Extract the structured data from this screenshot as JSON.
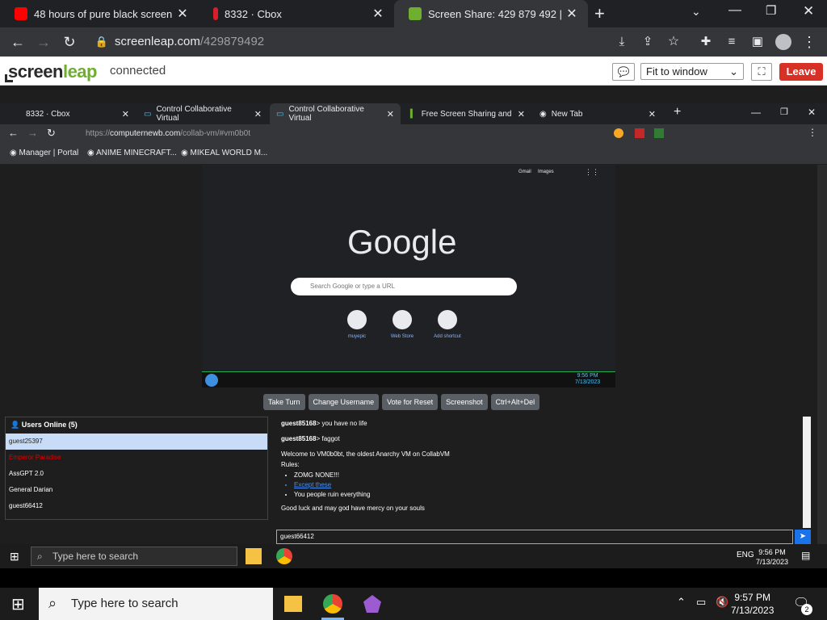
{
  "outer_tabs": [
    {
      "label": "48 hours of pure black screen in",
      "color": "#ff0000"
    },
    {
      "label": "8332 · Cbox",
      "color": "#d91e2a"
    },
    {
      "label": "Screen Share: 429 879 492 | Scre",
      "color": "#6fae2f"
    }
  ],
  "outer_url": {
    "domain": "screenleap.com",
    "path": "/429879492"
  },
  "screenleap": {
    "logo_a": "screen",
    "logo_b": "leap",
    "status": "connected",
    "fit_option": "Fit to window",
    "leave_label": "Leave"
  },
  "remote_tabs": [
    {
      "label": "8332 · Cbox"
    },
    {
      "label": "Control Collaborative Virtual"
    },
    {
      "label": "Control Collaborative Virtual"
    },
    {
      "label": "Free Screen Sharing and"
    },
    {
      "label": "New Tab"
    }
  ],
  "remote_url": {
    "prefix": "https://",
    "domain": "computernewb.com",
    "path": "/collab-vm/#vm0b0t"
  },
  "bookmarks": [
    "Manager | Portal",
    "ANIME MINECRAFT...",
    "MIKEAL WORLD M..."
  ],
  "vm_screen": {
    "top_links": [
      "Gmail",
      "Images"
    ],
    "google_logo": "Google",
    "search_placeholder": "Search Google or type a URL",
    "shortcuts": [
      "muyepic",
      "Web Store",
      "Add shortcut"
    ],
    "clock": "9:56 PM",
    "date": "7/13/2023"
  },
  "vm_buttons": [
    "Take Turn",
    "Change Username",
    "Vote for Reset",
    "Screenshot",
    "Ctrl+Alt+Del"
  ],
  "users": {
    "header": "Users Online (5)",
    "list": [
      "guest25397",
      "Emperor Paradise",
      "AssGPT 2.0",
      "General Darian",
      "guest66412"
    ]
  },
  "chat": {
    "msg1_user": "guest85168",
    "msg1_text": "> you have no life",
    "msg2_user": "guest85168",
    "msg2_text": "> faggot",
    "welcome": "Welcome to VM0b0bt, the oldest Anarchy VM on CollabVM",
    "rules_label": "Rules:",
    "rules": [
      "ZOMG NONE!!!",
      "Except these",
      "You people ruin everything"
    ],
    "goodluck": "Good luck and may god have mercy on your souls",
    "input_name": "guest66412"
  },
  "remote_taskbar": {
    "search": "Type here to search",
    "lang": "ENG",
    "time": "9:56 PM",
    "date": "7/13/2023"
  },
  "taskbar": {
    "search": "Type here to search",
    "time": "9:57 PM",
    "date": "7/13/2023",
    "notif_count": "2"
  }
}
